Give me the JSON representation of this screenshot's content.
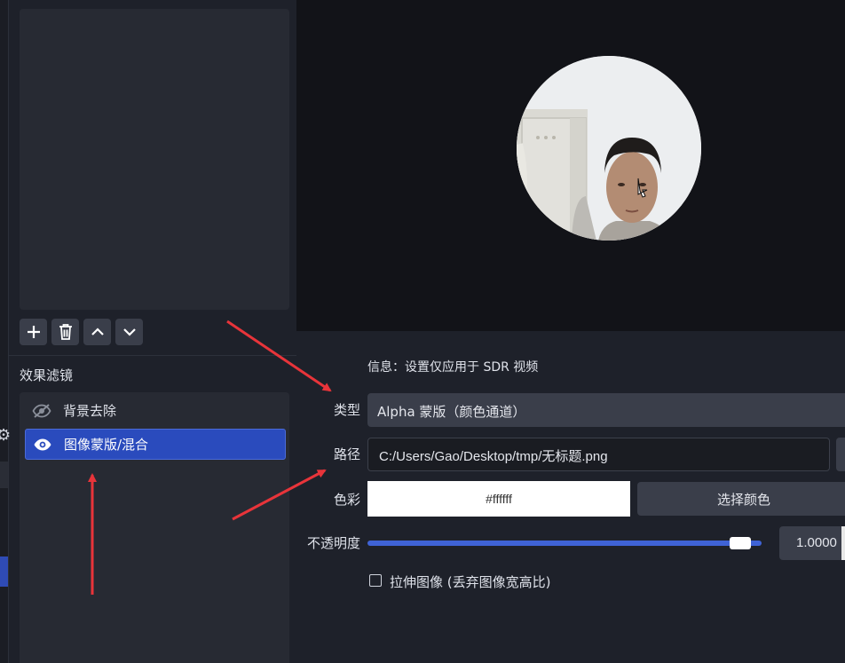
{
  "sources": {
    "toolbar": [
      {
        "icon": "plus-icon"
      },
      {
        "icon": "trash-icon"
      },
      {
        "icon": "chevron-up-icon"
      },
      {
        "icon": "chevron-down-icon"
      }
    ]
  },
  "filters": {
    "title": "效果滤镜",
    "items": [
      {
        "label": "背景去除",
        "icon": "eye-hidden-icon",
        "selected": false
      },
      {
        "label": "图像蒙版/混合",
        "icon": "eye-icon",
        "selected": true
      }
    ]
  },
  "properties": {
    "info": "信息：设置仅应用于 SDR 视频",
    "type_label": "类型",
    "type_value": "Alpha 蒙版（颜色通道）",
    "path_label": "路径",
    "path_value": "C:/Users/Gao/Desktop/tmp/无标题.png",
    "color_label": "色彩",
    "color_value": "#ffffff",
    "color_button": "选择颜色",
    "opacity_label": "不透明度",
    "opacity_value": "1.0000",
    "opacity_fraction": 1.0,
    "stretch_label": "拉伸图像 (丢弃图像宽高比)",
    "stretch_checked": false
  },
  "colors": {
    "accent": "#2a4bbd",
    "slider": "#3f63d6",
    "annotation_arrow": "#e8343a"
  }
}
